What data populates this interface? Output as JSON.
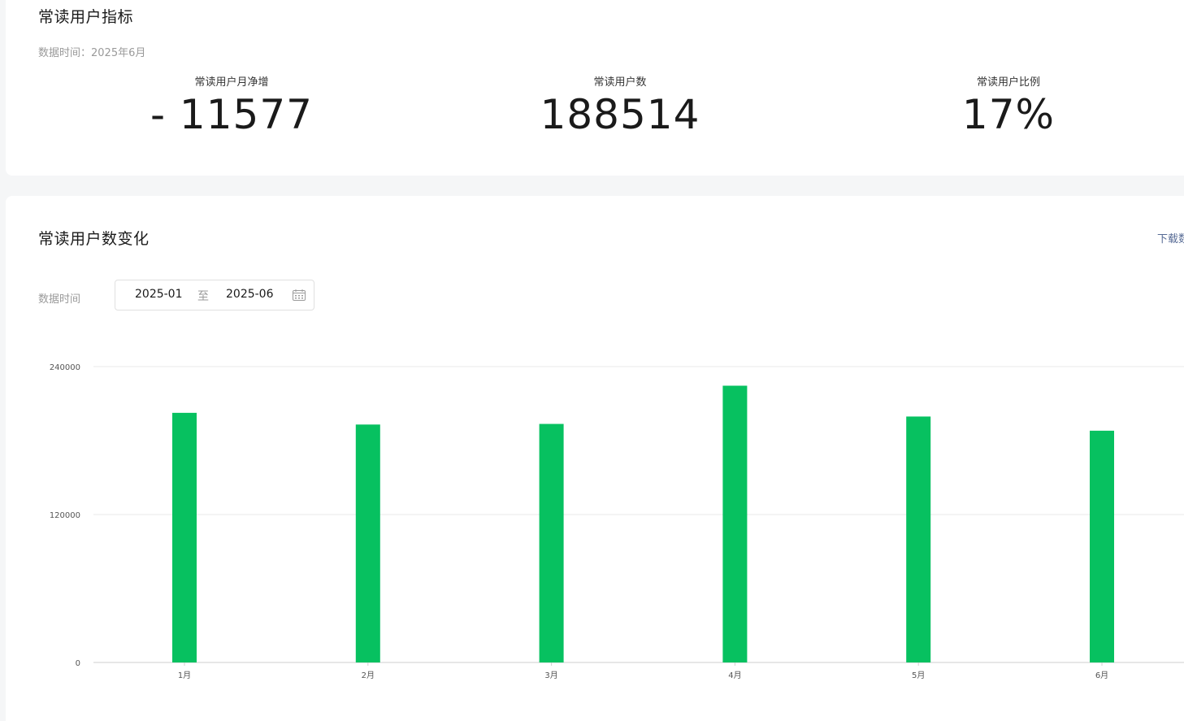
{
  "metrics_card": {
    "title": "常读用户指标",
    "data_time": "数据时间：2025年6月",
    "items": [
      {
        "label": "常读用户月净增",
        "value": "- 11577"
      },
      {
        "label": "常读用户数",
        "value": "188514"
      },
      {
        "label": "常读用户比例",
        "value": "17%"
      }
    ]
  },
  "chart_card": {
    "title": "常读用户数变化",
    "download_label": "下载数",
    "filter_label": "数据时间",
    "date_start": "2025-01",
    "date_separator": "至",
    "date_end": "2025-06",
    "calendar_icon": "calendar-icon"
  },
  "colors": {
    "bar": "#07c160",
    "link": "#576b95",
    "background": "#f5f6f7"
  },
  "chart_data": {
    "type": "bar",
    "categories": [
      "1月",
      "2月",
      "3月",
      "4月",
      "5月",
      "6月"
    ],
    "values": [
      202500,
      193000,
      193500,
      224500,
      199500,
      188000
    ],
    "yticks": [
      "0",
      "120000",
      "240000"
    ],
    "ylim": [
      0,
      240000
    ],
    "grid": true,
    "legend": "none"
  }
}
